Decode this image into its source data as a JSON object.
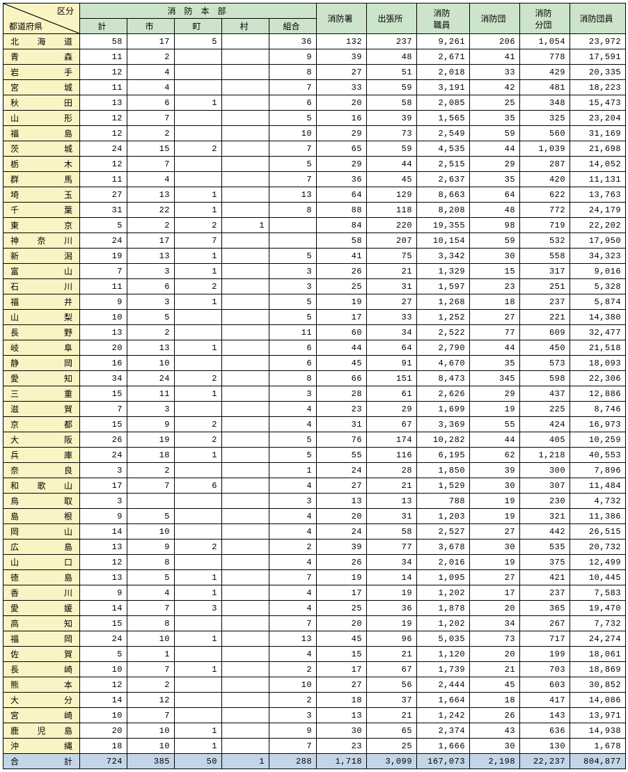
{
  "header": {
    "corner_top": "区分",
    "corner_bottom": "都道府県",
    "fire_hq": "消　防　本　部",
    "sub_total": "計",
    "sub_city": "市",
    "sub_town": "町",
    "sub_village": "村",
    "sub_union": "組合",
    "stations": "消防署",
    "branches": "出張所",
    "personnel1": "消防",
    "personnel2": "職員",
    "brigades": "消防団",
    "sub_brigades1": "消防",
    "sub_brigades2": "分団",
    "brigade_members": "消防団員"
  },
  "groups": [
    {
      "rows": [
        {
          "pref": "北　海　道",
          "v": [
            "58",
            "17",
            "5",
            "",
            "36",
            "132",
            "237",
            "9,261",
            "206",
            "1,054",
            "23,972"
          ]
        },
        {
          "pref": "青　　　森",
          "v": [
            "11",
            "2",
            "",
            "",
            "9",
            "39",
            "48",
            "2,671",
            "41",
            "778",
            "17,591"
          ]
        },
        {
          "pref": "岩　　　手",
          "v": [
            "12",
            "4",
            "",
            "",
            "8",
            "27",
            "51",
            "2,018",
            "33",
            "429",
            "20,335"
          ]
        },
        {
          "pref": "宮　　　城",
          "v": [
            "11",
            "4",
            "",
            "",
            "7",
            "33",
            "59",
            "3,191",
            "42",
            "481",
            "18,223"
          ]
        },
        {
          "pref": "秋　　　田",
          "v": [
            "13",
            "6",
            "1",
            "",
            "6",
            "20",
            "58",
            "2,085",
            "25",
            "348",
            "15,473"
          ]
        },
        {
          "pref": "山　　　形",
          "v": [
            "12",
            "7",
            "",
            "",
            "5",
            "16",
            "39",
            "1,565",
            "35",
            "325",
            "23,204"
          ]
        },
        {
          "pref": "福　　　島",
          "v": [
            "12",
            "2",
            "",
            "",
            "10",
            "29",
            "73",
            "2,549",
            "59",
            "560",
            "31,169"
          ]
        }
      ]
    },
    {
      "rows": [
        {
          "pref": "茨　　　城",
          "v": [
            "24",
            "15",
            "2",
            "",
            "7",
            "65",
            "59",
            "4,535",
            "44",
            "1,039",
            "21,698"
          ]
        },
        {
          "pref": "栃　　　木",
          "v": [
            "12",
            "7",
            "",
            "",
            "5",
            "29",
            "44",
            "2,515",
            "29",
            "287",
            "14,052"
          ]
        },
        {
          "pref": "群　　　馬",
          "v": [
            "11",
            "4",
            "",
            "",
            "7",
            "36",
            "45",
            "2,637",
            "35",
            "420",
            "11,131"
          ]
        },
        {
          "pref": "埼　　　玉",
          "v": [
            "27",
            "13",
            "1",
            "",
            "13",
            "64",
            "129",
            "8,663",
            "64",
            "622",
            "13,763"
          ]
        },
        {
          "pref": "千　　　葉",
          "v": [
            "31",
            "22",
            "1",
            "",
            "8",
            "88",
            "118",
            "8,208",
            "48",
            "772",
            "24,179"
          ]
        },
        {
          "pref": "東　　　京",
          "v": [
            "5",
            "2",
            "2",
            "1",
            "",
            "84",
            "220",
            "19,355",
            "98",
            "719",
            "22,202"
          ]
        },
        {
          "pref": "神　奈　川",
          "v": [
            "24",
            "17",
            "7",
            "",
            "",
            "58",
            "207",
            "10,154",
            "59",
            "532",
            "17,950"
          ]
        }
      ]
    },
    {
      "rows": [
        {
          "pref": "新　　　潟",
          "v": [
            "19",
            "13",
            "1",
            "",
            "5",
            "41",
            "75",
            "3,342",
            "30",
            "558",
            "34,323"
          ]
        },
        {
          "pref": "富　　　山",
          "v": [
            "7",
            "3",
            "1",
            "",
            "3",
            "26",
            "21",
            "1,329",
            "15",
            "317",
            "9,016"
          ]
        },
        {
          "pref": "石　　　川",
          "v": [
            "11",
            "6",
            "2",
            "",
            "3",
            "25",
            "31",
            "1,597",
            "23",
            "251",
            "5,328"
          ]
        },
        {
          "pref": "福　　　井",
          "v": [
            "9",
            "3",
            "1",
            "",
            "5",
            "19",
            "27",
            "1,268",
            "18",
            "237",
            "5,874"
          ]
        }
      ]
    },
    {
      "rows": [
        {
          "pref": "山　　　梨",
          "v": [
            "10",
            "5",
            "",
            "",
            "5",
            "17",
            "33",
            "1,252",
            "27",
            "221",
            "14,380"
          ]
        },
        {
          "pref": "長　　　野",
          "v": [
            "13",
            "2",
            "",
            "",
            "11",
            "60",
            "34",
            "2,522",
            "77",
            "609",
            "32,477"
          ]
        },
        {
          "pref": "岐　　　阜",
          "v": [
            "20",
            "13",
            "1",
            "",
            "6",
            "44",
            "64",
            "2,790",
            "44",
            "450",
            "21,518"
          ]
        },
        {
          "pref": "静　　　岡",
          "v": [
            "16",
            "10",
            "",
            "",
            "6",
            "45",
            "91",
            "4,670",
            "35",
            "573",
            "18,093"
          ]
        },
        {
          "pref": "愛　　　知",
          "v": [
            "34",
            "24",
            "2",
            "",
            "8",
            "66",
            "151",
            "8,473",
            "345",
            "598",
            "22,306"
          ]
        },
        {
          "pref": "三　　　重",
          "v": [
            "15",
            "11",
            "1",
            "",
            "3",
            "28",
            "61",
            "2,626",
            "29",
            "437",
            "12,886"
          ]
        }
      ]
    },
    {
      "rows": [
        {
          "pref": "滋　　　賀",
          "v": [
            "7",
            "3",
            "",
            "",
            "4",
            "23",
            "29",
            "1,699",
            "19",
            "225",
            "8,746"
          ]
        },
        {
          "pref": "京　　　都",
          "v": [
            "15",
            "9",
            "2",
            "",
            "4",
            "31",
            "67",
            "3,369",
            "55",
            "424",
            "16,973"
          ]
        },
        {
          "pref": "大　　　阪",
          "v": [
            "26",
            "19",
            "2",
            "",
            "5",
            "76",
            "174",
            "10,282",
            "44",
            "405",
            "10,259"
          ]
        },
        {
          "pref": "兵　　　庫",
          "v": [
            "24",
            "18",
            "1",
            "",
            "5",
            "55",
            "116",
            "6,195",
            "62",
            "1,218",
            "40,553"
          ]
        },
        {
          "pref": "奈　　　良",
          "v": [
            "3",
            "2",
            "",
            "",
            "1",
            "24",
            "28",
            "1,850",
            "39",
            "300",
            "7,896"
          ]
        },
        {
          "pref": "和　歌　山",
          "v": [
            "17",
            "7",
            "6",
            "",
            "4",
            "27",
            "21",
            "1,529",
            "30",
            "307",
            "11,484"
          ]
        }
      ]
    },
    {
      "rows": [
        {
          "pref": "鳥　　　取",
          "v": [
            "3",
            "",
            "",
            "",
            "3",
            "13",
            "13",
            "788",
            "19",
            "230",
            "4,732"
          ]
        },
        {
          "pref": "島　　　根",
          "v": [
            "9",
            "5",
            "",
            "",
            "4",
            "20",
            "31",
            "1,203",
            "19",
            "321",
            "11,386"
          ]
        },
        {
          "pref": "岡　　　山",
          "v": [
            "14",
            "10",
            "",
            "",
            "4",
            "24",
            "58",
            "2,527",
            "27",
            "442",
            "26,515"
          ]
        },
        {
          "pref": "広　　　島",
          "v": [
            "13",
            "9",
            "2",
            "",
            "2",
            "39",
            "77",
            "3,678",
            "30",
            "535",
            "20,732"
          ]
        },
        {
          "pref": "山　　　口",
          "v": [
            "12",
            "8",
            "",
            "",
            "4",
            "26",
            "34",
            "2,016",
            "19",
            "375",
            "12,499"
          ]
        }
      ]
    },
    {
      "rows": [
        {
          "pref": "徳　　　島",
          "v": [
            "13",
            "5",
            "1",
            "",
            "7",
            "19",
            "14",
            "1,095",
            "27",
            "421",
            "10,445"
          ]
        },
        {
          "pref": "香　　　川",
          "v": [
            "9",
            "4",
            "1",
            "",
            "4",
            "17",
            "19",
            "1,202",
            "17",
            "237",
            "7,583"
          ]
        },
        {
          "pref": "愛　　　媛",
          "v": [
            "14",
            "7",
            "3",
            "",
            "4",
            "25",
            "36",
            "1,878",
            "20",
            "365",
            "19,470"
          ]
        },
        {
          "pref": "高　　　知",
          "v": [
            "15",
            "8",
            "",
            "",
            "7",
            "20",
            "19",
            "1,202",
            "34",
            "267",
            "7,732"
          ]
        }
      ]
    },
    {
      "rows": [
        {
          "pref": "福　　　岡",
          "v": [
            "24",
            "10",
            "1",
            "",
            "13",
            "45",
            "96",
            "5,035",
            "73",
            "717",
            "24,274"
          ]
        },
        {
          "pref": "佐　　　賀",
          "v": [
            "5",
            "1",
            "",
            "",
            "4",
            "15",
            "21",
            "1,120",
            "20",
            "199",
            "18,061"
          ]
        },
        {
          "pref": "長　　　崎",
          "v": [
            "10",
            "7",
            "1",
            "",
            "2",
            "17",
            "67",
            "1,739",
            "21",
            "703",
            "18,869"
          ]
        },
        {
          "pref": "熊　　　本",
          "v": [
            "12",
            "2",
            "",
            "",
            "10",
            "27",
            "56",
            "2,444",
            "45",
            "603",
            "30,852"
          ]
        },
        {
          "pref": "大　　　分",
          "v": [
            "14",
            "12",
            "",
            "",
            "2",
            "18",
            "37",
            "1,664",
            "18",
            "417",
            "14,086"
          ]
        },
        {
          "pref": "宮　　　崎",
          "v": [
            "10",
            "7",
            "",
            "",
            "3",
            "13",
            "21",
            "1,242",
            "26",
            "143",
            "13,971"
          ]
        },
        {
          "pref": "鹿　児　島",
          "v": [
            "20",
            "10",
            "1",
            "",
            "9",
            "30",
            "65",
            "2,374",
            "43",
            "636",
            "14,938"
          ]
        },
        {
          "pref": "沖　　　縄",
          "v": [
            "18",
            "10",
            "1",
            "",
            "7",
            "23",
            "25",
            "1,666",
            "30",
            "130",
            "1,678"
          ]
        }
      ]
    }
  ],
  "total": {
    "label": "合　　　計",
    "v": [
      "724",
      "385",
      "50",
      "1",
      "288",
      "1,718",
      "3,099",
      "167,073",
      "2,198",
      "22,237",
      "804,877"
    ]
  }
}
